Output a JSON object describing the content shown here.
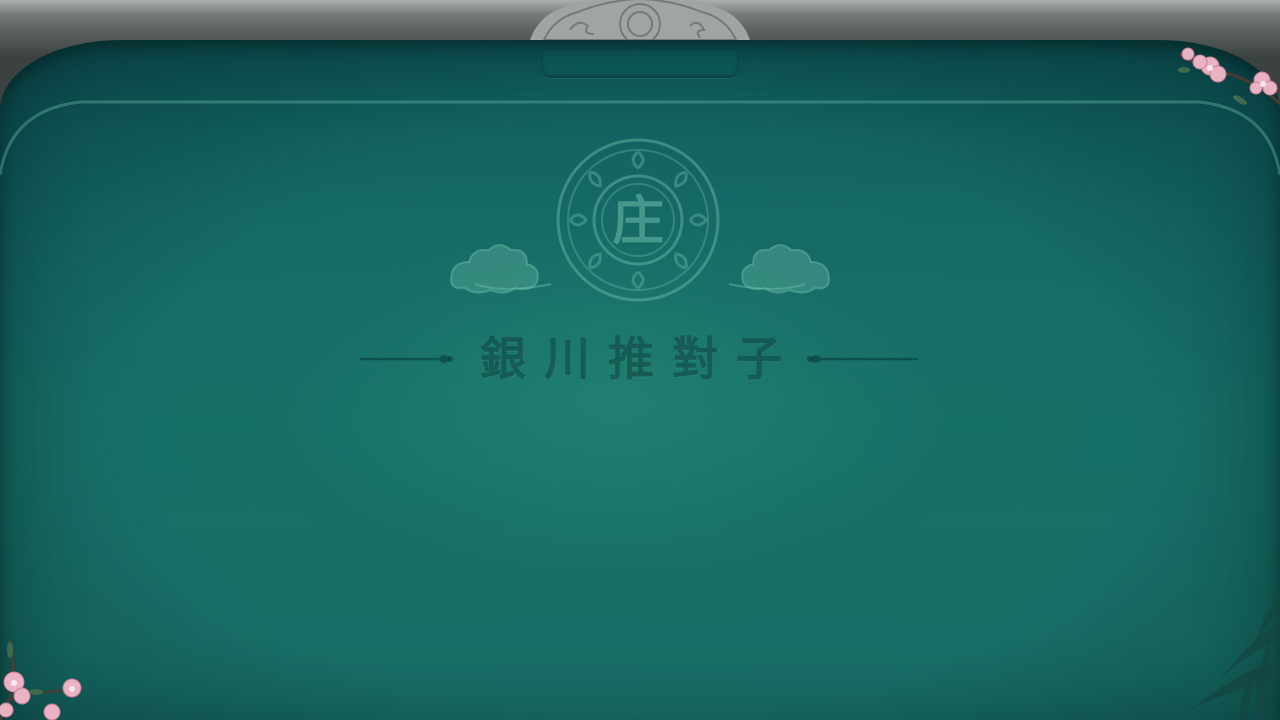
{
  "table": {
    "felt_color": "#177067",
    "frame_color": "#3c4240",
    "banker_char": "庄",
    "game_title": "銀川推對子"
  },
  "decorations": {
    "top_medallion": "ornament-medallion-icon",
    "emblem": "banker-emblem-icon",
    "clouds": "auspicious-cloud-icon",
    "flowers": "peach-blossom-icon",
    "bamboo": "bamboo-leaves-icon"
  }
}
